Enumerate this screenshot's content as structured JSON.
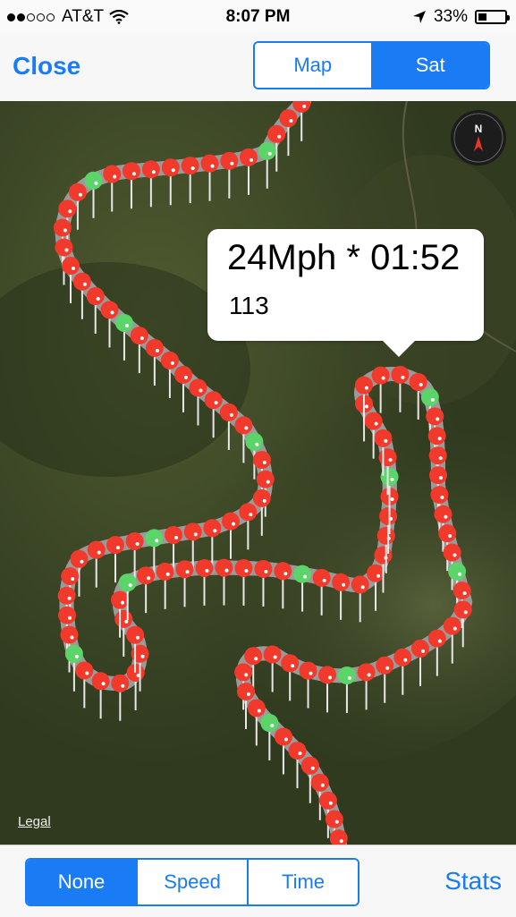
{
  "status_bar": {
    "carrier": "AT&T",
    "time": "8:07 PM",
    "battery_percent": "33%",
    "battery_level": 0.33,
    "signal_bars": 2,
    "signal_total": 5
  },
  "navbar": {
    "close_label": "Close",
    "map_type": {
      "options": [
        "Map",
        "Sat"
      ],
      "selected": "Sat"
    }
  },
  "map": {
    "legal_label": "Legal",
    "compass_letter": "N",
    "callout": {
      "title": "24Mph * 01:52",
      "subtitle": "113"
    },
    "colors": {
      "slow_pin": "#f23a2c",
      "fast_pin": "#5bd46a",
      "accent": "#1a7cf5"
    }
  },
  "toolbar": {
    "color_mode": {
      "options": [
        "None",
        "Speed",
        "Time"
      ],
      "selected": "None"
    },
    "stats_label": "Stats"
  }
}
